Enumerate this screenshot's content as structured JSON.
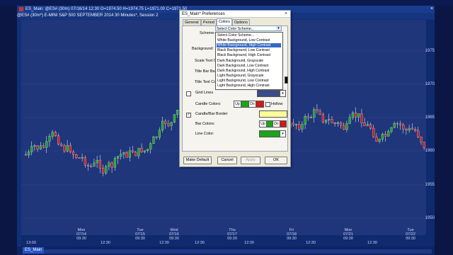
{
  "window": {
    "title": "ES_Main: @ES# (30m) 07/16/14 12:30 O=1974.50 H=1974.75 L=1971.00 C=1971.50",
    "subtitle": "@ES# (30m*) E-MINI S&P 500 SEPTEMBER 2014 30 Minutes*, Session 2",
    "close_glyph": "×"
  },
  "chart": {
    "price_labels": [
      "1975",
      "1970",
      "1965",
      "1960",
      "1955",
      "1950"
    ],
    "time_labels": [
      {
        "day": "Mon",
        "date": "07/14",
        "time": "09:30"
      },
      {
        "day": "",
        "date": "",
        "time": "12:30"
      },
      {
        "day": "Tue",
        "date": "07/15",
        "time": "09:30"
      },
      {
        "day": "",
        "date": "",
        "time": "12:30"
      },
      {
        "day": "Wed",
        "date": "07/16",
        "time": "09:30"
      },
      {
        "day": "",
        "date": "",
        "time": "12:30"
      },
      {
        "day": "Thu",
        "date": "07/17",
        "time": "09:30"
      },
      {
        "day": "",
        "date": "",
        "time": "12:30"
      },
      {
        "day": "Fri",
        "date": "07/18",
        "time": "09:30"
      },
      {
        "day": "",
        "date": "",
        "time": "12:30"
      },
      {
        "day": "Mon",
        "date": "07/21",
        "time": "09:30"
      },
      {
        "day": "",
        "date": "",
        "time": "12:30"
      },
      {
        "day": "Tue",
        "date": "07/22",
        "time": "09:30"
      }
    ],
    "left_time_label": "13:00",
    "up_color": "#1aa51a",
    "down_color": "#d11a1a",
    "background": "#20367a"
  },
  "tabs": {
    "active_window": "ES_Main"
  },
  "dialog": {
    "title": "ES_Main* Preferences",
    "close_glyph": "×",
    "tabs": [
      "General",
      "Period",
      "Colors",
      "Options"
    ],
    "active_tab": "Colors",
    "scheme_label": "Scheme:",
    "scheme_value": "Select Color Scheme...",
    "scheme_options": [
      "Select Color Scheme...",
      "White Background, Low Contrast",
      "White Background, High Contrast",
      "Black Background, Low Contrast",
      "Black Background, High Contrast",
      "Dark Background, Grayscale",
      "Dark Background, Low Contrast",
      "Dark Background, High Contrast",
      "Light Background, Grayscale",
      "Light Background, Low Contrast",
      "Light Background, High Contrast"
    ],
    "scheme_selected_index": 2,
    "background_label": "Background:",
    "scale_text_label": "Scale Text C",
    "title_bar_label": "Title Bar Ba",
    "title_text_label": "Title Text Co",
    "grid_lines_label": "Grid Lines",
    "candle_colors_label": "Candle Colors:",
    "up_label": "Up",
    "dn_label": "Dn",
    "hollow_label": "Hollow",
    "candle_border_label": "Candle/Bar Border",
    "bar_colors_label": "Bar Colors:",
    "line_color_label": "Line Color:",
    "buttons": {
      "make_default": "Make Default",
      "cancel": "Cancel",
      "apply": "Apply",
      "ok": "OK"
    },
    "colors": {
      "grid": "#3a4a8a",
      "up": "#1aa51a",
      "down": "#d11a1a",
      "border": "#ffff99",
      "line": "#1aa51a"
    }
  }
}
